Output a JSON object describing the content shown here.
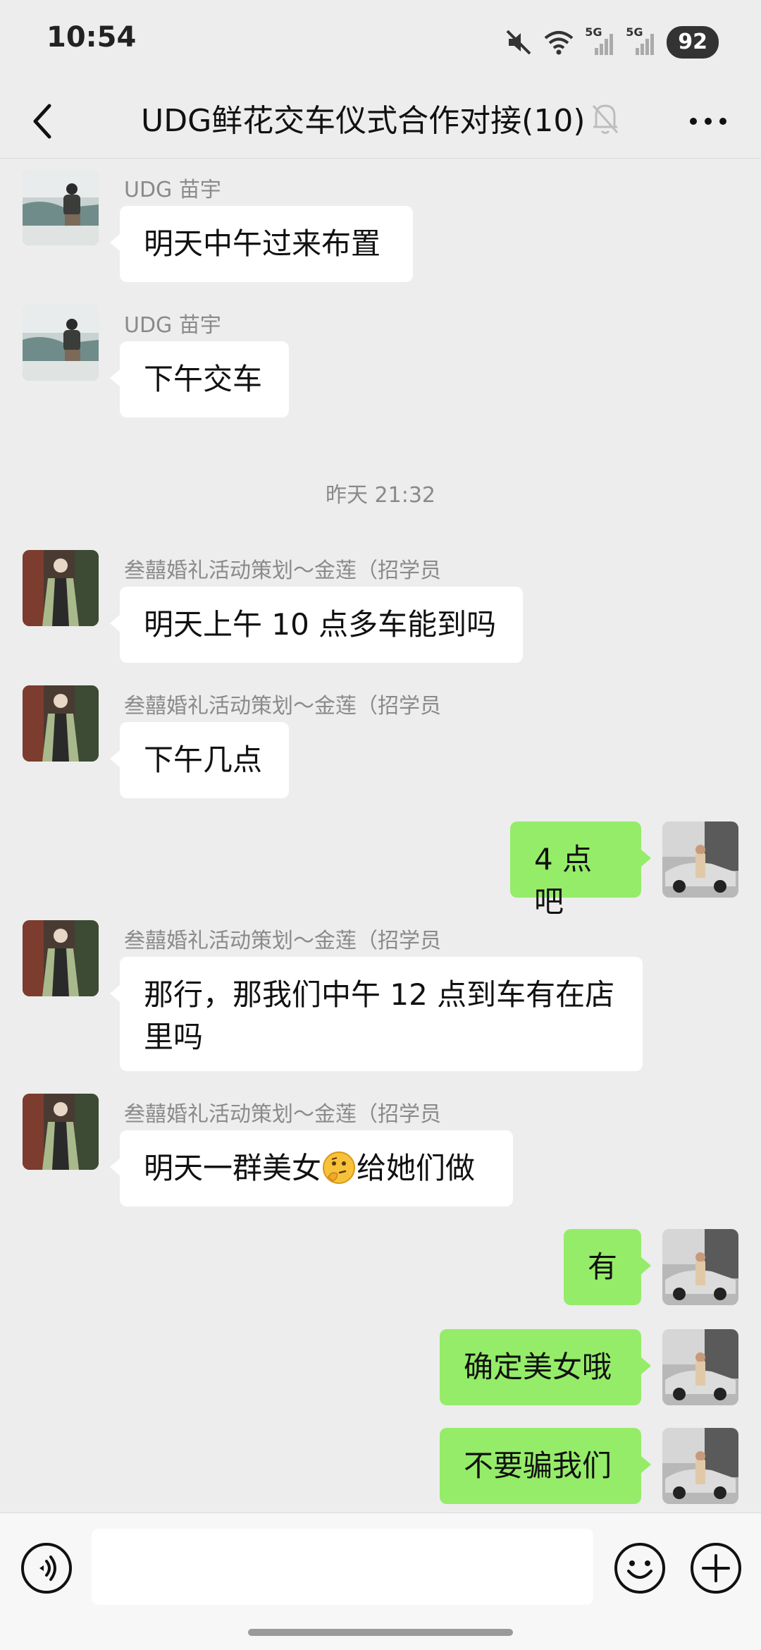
{
  "status_bar": {
    "time": "10:54",
    "battery": "92",
    "net1": "5G",
    "net2": "5G"
  },
  "header": {
    "title": "UDG鲜花交车仪式合作对接(10)"
  },
  "messages": [
    {
      "direction": "in",
      "sender": "UDG  苗宇",
      "text": "明天中午过来布置"
    },
    {
      "direction": "in",
      "sender": "UDG  苗宇",
      "text": "下午交车"
    },
    {
      "type": "timestamp",
      "text": "昨天 21:32"
    },
    {
      "direction": "in",
      "sender": "叁囍婚礼活动策划～金莲（招学员",
      "text": "明天上午 10 点多车能到吗"
    },
    {
      "direction": "in",
      "sender": "叁囍婚礼活动策划～金莲（招学员",
      "text": "下午几点"
    },
    {
      "direction": "out",
      "text": "4 点吧"
    },
    {
      "direction": "in",
      "sender": "叁囍婚礼活动策划～金莲（招学员",
      "text_line1": "那行，那我们中午 12 点到车有在店",
      "text_line2": "里吗"
    },
    {
      "direction": "in",
      "sender": "叁囍婚礼活动策划～金莲（招学员",
      "text_before": "明天一群美女",
      "emoji": "thinking-face-icon",
      "text_after": "给她们做"
    },
    {
      "direction": "out",
      "text": "有"
    },
    {
      "direction": "out",
      "text": "确定美女哦"
    },
    {
      "direction": "out",
      "text": "不要骗我们"
    }
  ],
  "input": {
    "value": ""
  },
  "colors": {
    "background": "#ededed",
    "incoming_bubble": "#ffffff",
    "outgoing_bubble": "#95ec69",
    "sender_text": "#8a8a8a"
  }
}
